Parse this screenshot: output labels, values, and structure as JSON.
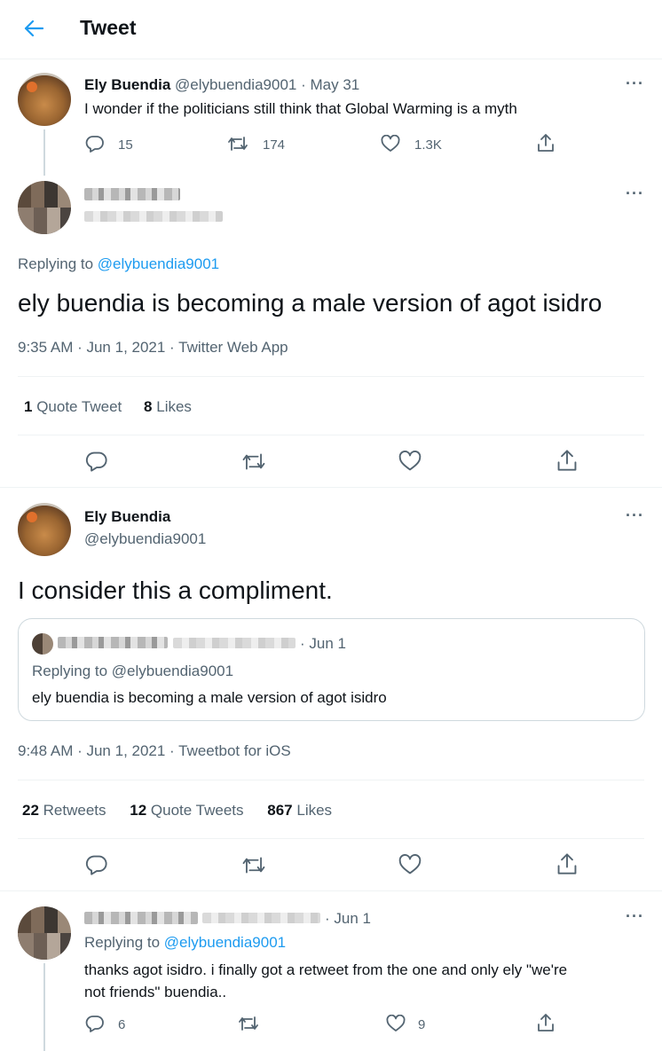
{
  "header": {
    "title": "Tweet"
  },
  "parent_tweet": {
    "name": "Ely Buendia",
    "handle": "@elybuendia9001",
    "date": "· May 31",
    "text": "I wonder if the politicians still think that Global Warming is a myth",
    "replies": "15",
    "retweets": "174",
    "likes": "1.3K"
  },
  "focus_tweet": {
    "replying_label": "Replying to",
    "replying_handle": "@elybuendia9001",
    "text": "ely buendia is becoming a male version of agot isidro",
    "meta": "9:35 AM · Jun 1, 2021 · Twitter Web App",
    "stats": {
      "quote_count": "1",
      "quote_label": "Quote Tweet",
      "like_count": "8",
      "like_label": "Likes"
    }
  },
  "reply_tweet": {
    "name": "Ely Buendia",
    "handle": "@elybuendia9001",
    "text": "I consider this a compliment.",
    "quote": {
      "date": "· Jun 1",
      "replying": "Replying to @elybuendia9001",
      "text": "ely buendia is becoming a male version of agot isidro"
    },
    "meta": "9:48 AM · Jun 1, 2021 · Tweetbot for iOS",
    "stats": {
      "retweet_count": "22",
      "retweet_label": "Retweets",
      "quote_count": "12",
      "quote_label": "Quote Tweets",
      "like_count": "867",
      "like_label": "Likes"
    }
  },
  "last_tweet": {
    "date": "· Jun 1",
    "replying_label": "Replying to",
    "replying_handle": "@elybuendia9001",
    "text_line1": "thanks agot isidro. i finally got a retweet from the one and only ely \"we're",
    "text_line2": "not friends\" buendia..",
    "replies": "6",
    "likes": "9"
  },
  "more_glyph": "···",
  "colors": {
    "accent": "#1d9bf0",
    "muted": "#536471",
    "border": "#eff3f4"
  },
  "icons": [
    "back-arrow-icon",
    "reply-icon",
    "retweet-icon",
    "like-icon",
    "share-icon",
    "more-icon"
  ]
}
